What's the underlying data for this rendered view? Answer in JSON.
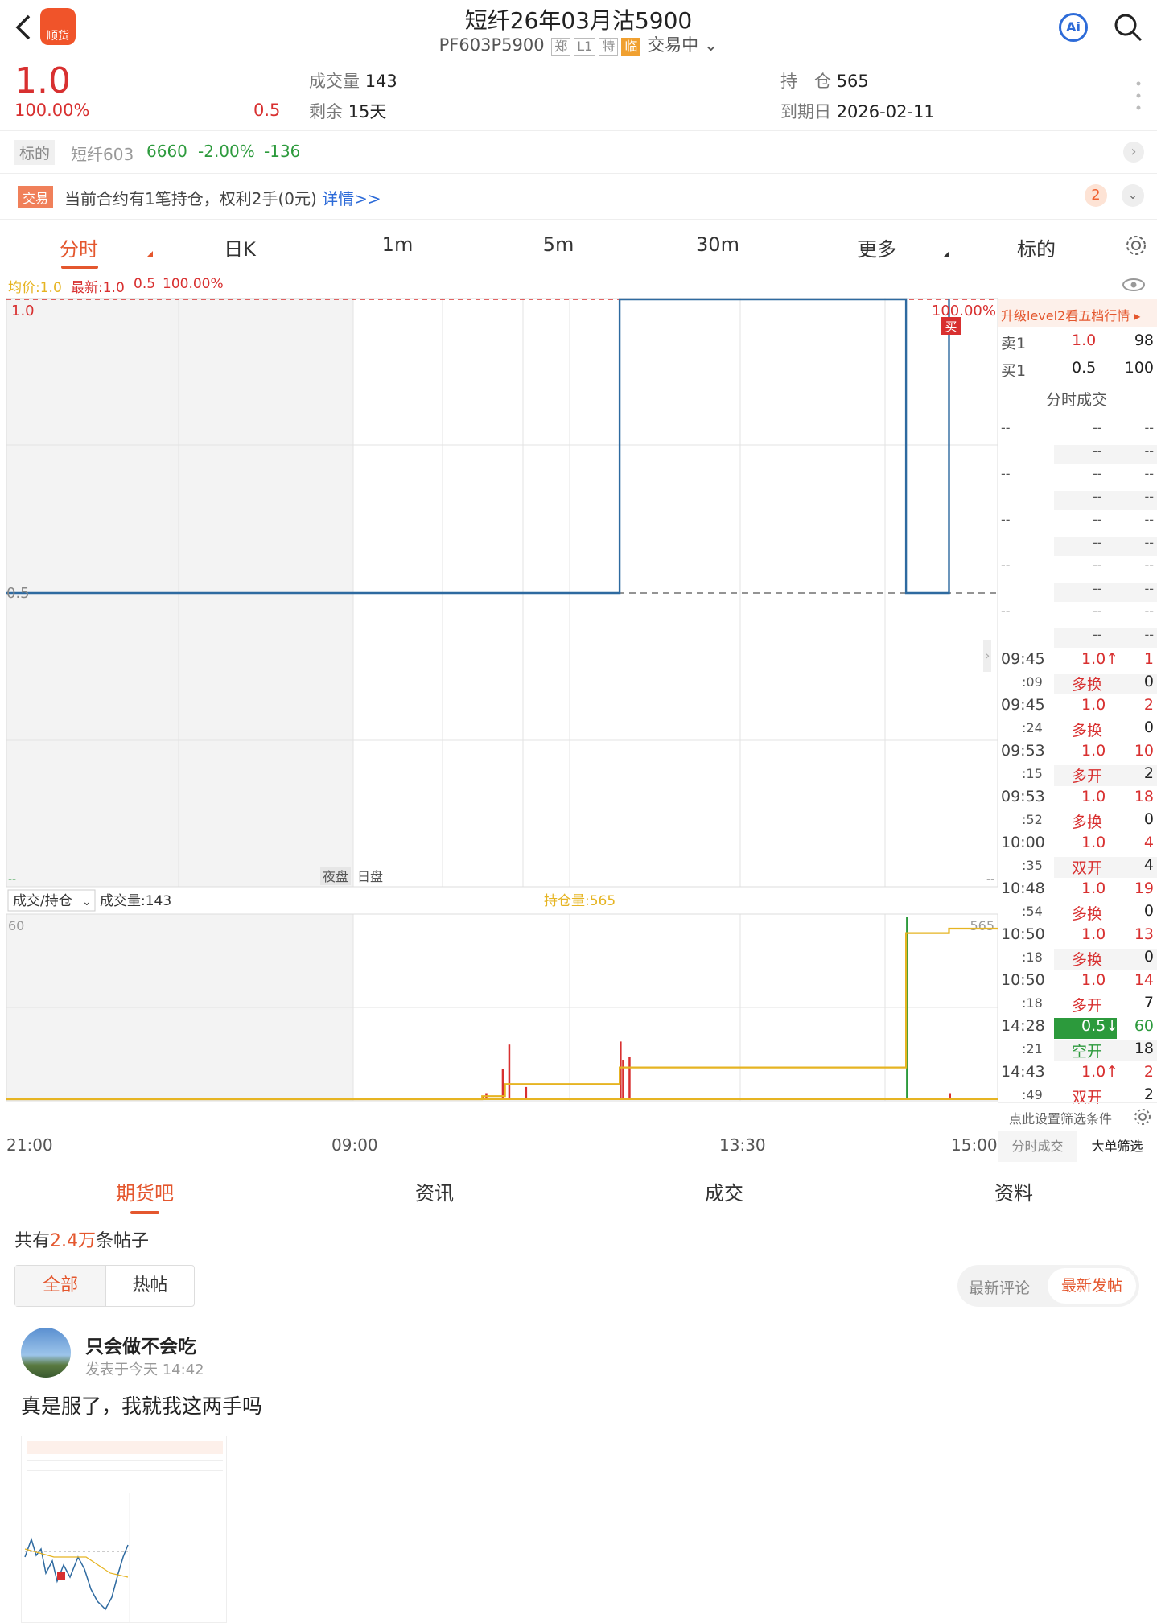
{
  "header": {
    "title": "短纤26年03月沽5900",
    "code": "PF603P5900",
    "tags": [
      "郑",
      "L1",
      "特"
    ],
    "tag_hl": "临",
    "status": "交易中",
    "logo_text": "顺货",
    "ai_label": "Ai"
  },
  "quote": {
    "price": "1.0",
    "pct": "100.00%",
    "change": "0.5",
    "vol_label": "成交量",
    "vol": "143",
    "remain_label": "剩余",
    "remain": "15天",
    "oi_label": "持　仓",
    "oi": "565",
    "expiry_label": "到期日",
    "expiry": "2026-02-11"
  },
  "underlying": {
    "label": "标的",
    "name": "短纤603",
    "price": "6660",
    "pct": "-2.00%",
    "chg": "-136"
  },
  "trade_notice": {
    "badge": "交易",
    "text": "当前合约有1笔持仓，权利2手(0元)",
    "link": "详情>>",
    "count": "2"
  },
  "tabs": [
    "分时",
    "日K",
    "1m",
    "5m",
    "30m",
    "更多",
    "标的"
  ],
  "info_bar": {
    "avg": "均价:1.0",
    "latest": "最新:1.0",
    "chg": "0.5",
    "pct": "100.00%"
  },
  "chart_labels": {
    "top_price": "1.0",
    "mid_price": "0.5",
    "top_pct": "100.00%",
    "buy_marker": "买",
    "night": "夜盘",
    "day": "日盘",
    "vol_select": "成交/持仓",
    "vol_text": "成交量:143",
    "oi_text": "持仓量:565",
    "vol_max": "60",
    "oi_max": "565",
    "x_ticks": [
      "21:00",
      "09:00",
      "13:30",
      "15:00"
    ]
  },
  "chart_data": {
    "type": "line",
    "series": [
      {
        "name": "最新",
        "points": [
          [
            "21:00",
            0.5
          ],
          [
            "10:48",
            0.5
          ],
          [
            "10:48",
            1.0
          ],
          [
            "14:28",
            1.0
          ],
          [
            "14:28",
            0.5
          ],
          [
            "14:43",
            0.5
          ],
          [
            "14:43",
            1.0
          ]
        ]
      }
    ],
    "volume": [
      {
        "time": "09:45",
        "v": 1
      },
      {
        "time": "09:45",
        "v": 2
      },
      {
        "time": "09:53",
        "v": 10
      },
      {
        "time": "09:53",
        "v": 18
      },
      {
        "time": "10:00",
        "v": 4
      },
      {
        "time": "10:48",
        "v": 19
      },
      {
        "time": "10:50",
        "v": 13
      },
      {
        "time": "10:50",
        "v": 14
      },
      {
        "time": "14:28",
        "v": 60
      },
      {
        "time": "14:43",
        "v": 2
      }
    ],
    "ylim": [
      0.5,
      1.0
    ]
  },
  "orderbook": {
    "upgrade": "升级level2看五档行情",
    "ask_label": "卖1",
    "ask_price": "1.0",
    "ask_vol": "98",
    "bid_label": "买1",
    "bid_price": "0.5",
    "bid_vol": "100",
    "ticks_title": "分时成交",
    "filter": "点此设置筛选条件",
    "btn1": "分时成交",
    "btn2": "大单筛选",
    "ticks": [
      {
        "t": "09:45",
        "p": "1.0↑",
        "v": "1",
        "s": ":09",
        "k": "多换",
        "kv": "0",
        "pc": "#d83030",
        "kc": "#d83030"
      },
      {
        "t": "09:45",
        "p": "1.0",
        "v": "2",
        "s": ":24",
        "k": "多换",
        "kv": "0",
        "pc": "#d83030",
        "kc": "#d83030"
      },
      {
        "t": "09:53",
        "p": "1.0",
        "v": "10",
        "s": ":15",
        "k": "多开",
        "kv": "2",
        "pc": "#d83030",
        "kc": "#d83030"
      },
      {
        "t": "09:53",
        "p": "1.0",
        "v": "18",
        "s": ":52",
        "k": "多换",
        "kv": "0",
        "pc": "#d83030",
        "kc": "#d83030"
      },
      {
        "t": "10:00",
        "p": "1.0",
        "v": "4",
        "s": ":35",
        "k": "双开",
        "kv": "4",
        "pc": "#d83030",
        "kc": "#d83030"
      },
      {
        "t": "10:48",
        "p": "1.0",
        "v": "19",
        "s": ":54",
        "k": "多换",
        "kv": "0",
        "pc": "#d83030",
        "kc": "#d83030"
      },
      {
        "t": "10:50",
        "p": "1.0",
        "v": "13",
        "s": ":18",
        "k": "多换",
        "kv": "0",
        "pc": "#d83030",
        "kc": "#d83030"
      },
      {
        "t": "10:50",
        "p": "1.0",
        "v": "14",
        "s": ":18",
        "k": "多开",
        "kv": "7",
        "pc": "#d83030",
        "kc": "#d83030"
      },
      {
        "t": "14:28",
        "p": "0.5↓",
        "v": "60",
        "s": ":21",
        "k": "空开",
        "kv": "18",
        "pc": "#fff",
        "kc": "#2c9a3c",
        "green": true
      },
      {
        "t": "14:43",
        "p": "1.0↑",
        "v": "2",
        "s": ":49",
        "k": "双开",
        "kv": "2",
        "pc": "#d83030",
        "kc": "#d83030"
      }
    ]
  },
  "bottom_tabs": [
    "期货吧",
    "资讯",
    "成交",
    "资料"
  ],
  "forum": {
    "pre": "共有",
    "count": "2.4万",
    "post": "条帖子",
    "seg_all": "全部",
    "seg_hot": "热帖",
    "sort_a": "最新评论",
    "sort_b": "最新发帖"
  },
  "post": {
    "user": "只会做不会吃",
    "time": "发表于今天 14:42",
    "text": "真是服了，我就我这两手吗"
  }
}
